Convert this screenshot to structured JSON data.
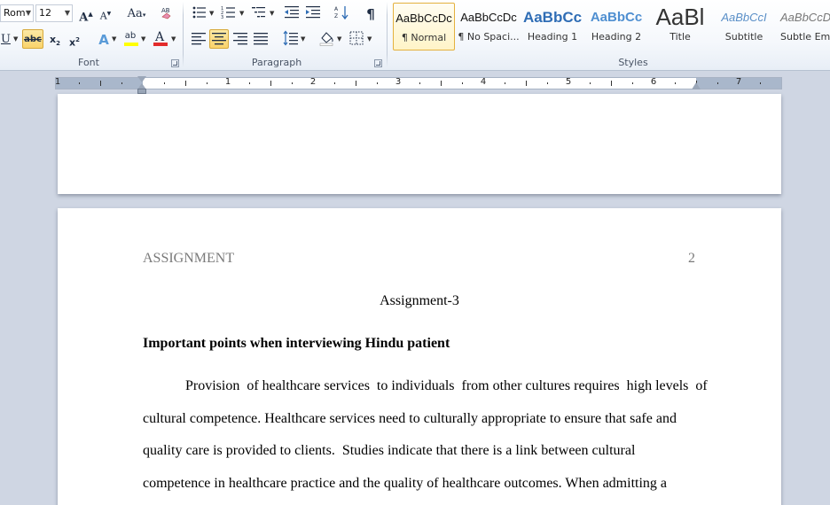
{
  "ribbon": {
    "font": {
      "name_value": "Rom",
      "size_value": "12",
      "group_label": "Font"
    },
    "paragraph": {
      "group_label": "Paragraph"
    },
    "styles": {
      "group_label": "Styles",
      "items": [
        {
          "preview": "AaBbCcDc",
          "name": "¶ Normal"
        },
        {
          "preview": "AaBbCcDc",
          "name": "¶ No Spaci..."
        },
        {
          "preview": "AaBbCc",
          "name": "Heading 1"
        },
        {
          "preview": "AaBbCc",
          "name": "Heading 2"
        },
        {
          "preview": "AaBl",
          "name": "Title"
        },
        {
          "preview": "AaBbCcI",
          "name": "Subtitle"
        },
        {
          "preview": "AaBbCcD",
          "name": "Subtle Em..."
        }
      ],
      "selected_index": 0
    }
  },
  "ruler": {
    "numbers": [
      "1",
      "1",
      "2",
      "3",
      "4",
      "5",
      "6",
      "7"
    ]
  },
  "document": {
    "running_head": "ASSIGNMENT",
    "page_number": "2",
    "title": "Assignment-3",
    "heading": "Important points when interviewing  Hindu patient",
    "body_lines": [
      "Provision  of healthcare services  to individuals  from other cultures requires  high levels  of",
      "cultural competence. Healthcare services need to culturally appropriate to ensure that safe and",
      "quality care is provided to clients.  Studies indicate that there is a link between cultural",
      "competence in healthcare practice and the quality of healthcare outcomes. When admitting a"
    ]
  },
  "colors": {
    "accent_selected": "#f9d36b",
    "highlight_yellow": "#ffff00",
    "font_color_red": "#e32b2b",
    "heading_blue": "#2f6db5"
  }
}
